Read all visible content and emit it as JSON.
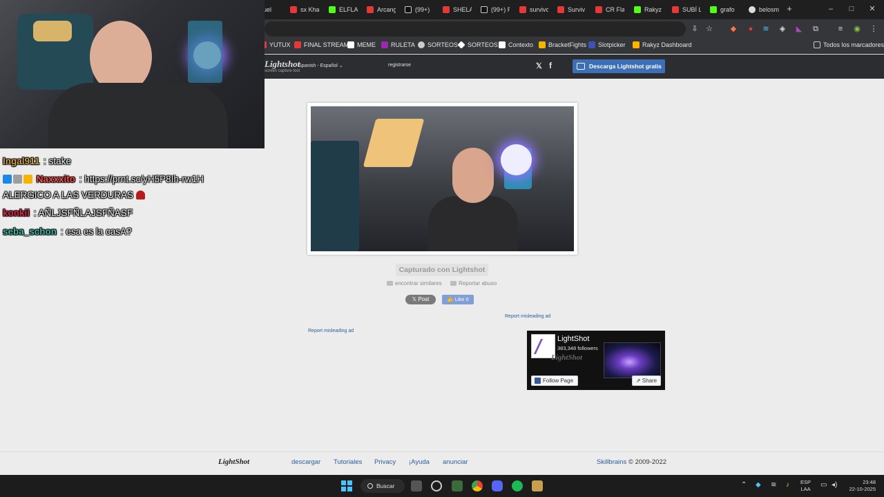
{
  "browser": {
    "tabs": [
      {
        "label": "Anuel",
        "color": "#e53935"
      },
      {
        "label": "sx Kha",
        "color": "#e53935"
      },
      {
        "label": "ELFLA",
        "color": "#53fc18"
      },
      {
        "label": "Arcang",
        "color": "#e53935"
      },
      {
        "label": "(99+) ",
        "color": "#111111"
      },
      {
        "label": "SHELA",
        "color": "#e53935"
      },
      {
        "label": "(99+) R",
        "color": "#111111"
      },
      {
        "label": "survivo",
        "color": "#e53935"
      },
      {
        "label": "Surviv",
        "color": "#e53935"
      },
      {
        "label": "CR Fla",
        "color": "#e53935"
      },
      {
        "label": "Rakyz",
        "color": "#53fc18"
      },
      {
        "label": "SUBÍ L",
        "color": "#e53935"
      },
      {
        "label": "grafo",
        "color": "#53fc18"
      },
      {
        "label": "belosm",
        "color": "#dddddd"
      }
    ],
    "new_tab": "+",
    "window_controls": {
      "minimize": "–",
      "maximize": "□",
      "close": "✕"
    },
    "bookmarks": [
      {
        "label": "YUTUX",
        "color": "#e53935"
      },
      {
        "label": "FINAL STREAM",
        "color": "#e53935"
      },
      {
        "label": "MEME",
        "color": "#ffffff"
      },
      {
        "label": "RULETA",
        "color": "#9c27b0"
      },
      {
        "label": "SORTEOS",
        "color": "#cccccc"
      },
      {
        "label": "SORTEOS",
        "color": "#ffffff"
      },
      {
        "label": "Contexto",
        "color": "#ffffff"
      },
      {
        "label": "BracketFights",
        "color": "#f4b400"
      },
      {
        "label": "Slotpicker",
        "color": "#3f51b5"
      },
      {
        "label": "Rakyz Dashboard",
        "color": "#ffb300"
      }
    ],
    "all_bookmarks": "Todos los marcadores"
  },
  "lightshot": {
    "logo": "Lightshot",
    "tagline": "screen capture tool",
    "language": "Spanish - Español",
    "language_caret": "⌄",
    "register": "registrarse",
    "twitter_glyph": "𝕏",
    "facebook_glyph": "f",
    "download_label": "Descarga Lightshot gratis",
    "captured_label": "Capturado con Lightshot",
    "find_similar": "encontrar similares",
    "report_abuse": "Reportar abuso",
    "x_post": "𝕏 Post",
    "fb_like": "👍 Like 0",
    "report_misleading_ad_1": "Report misleading ad",
    "report_misleading_ad_2": "Report misleading ad"
  },
  "fb_widget": {
    "page_name": "LightShot",
    "followers": "383,348 followers",
    "watermark": "LightShot",
    "follow_label": "Follow Page",
    "share_label": "⇗ Share"
  },
  "footer": {
    "logo": "LightShot",
    "links": [
      "descargar",
      "Tutoriales",
      "Privacy",
      "¡Ayuda",
      "anunciar"
    ],
    "company": "Skillbrains",
    "copyright": "© 2009-2022"
  },
  "taskbar": {
    "search_label": "Buscar",
    "lang_line1": "ESP",
    "lang_line2": "LAA",
    "time": "23:48",
    "date": "22-10-2025",
    "chevron": "⌃"
  },
  "chat": [
    {
      "user": "Ingal911",
      "user_color": "#c8a04a",
      "sep": " : ",
      "message": "stake",
      "badges": []
    },
    {
      "user": "Naxxxito",
      "user_color": "#ff4d4d",
      "sep": " : ",
      "message": "https://prnt.sc/yH5P8Ih-rw1H",
      "badges": [
        "#1e88e5",
        "#9e9e9e",
        "#f4b400"
      ]
    },
    {
      "user": "",
      "user_color": "#ffffff",
      "sep": "",
      "message": "ALERGICO A LAS VERDURAS",
      "badges": []
    },
    {
      "user": "konkii",
      "user_color": "#e0204a",
      "sep": " : ",
      "message": "AÑLJSFÑLAJSFÑASF",
      "badges": []
    },
    {
      "user": "seba_schon",
      "user_color": "#3fb89f",
      "sep": " : ",
      "message": "esa es la casA?",
      "badges": []
    }
  ]
}
